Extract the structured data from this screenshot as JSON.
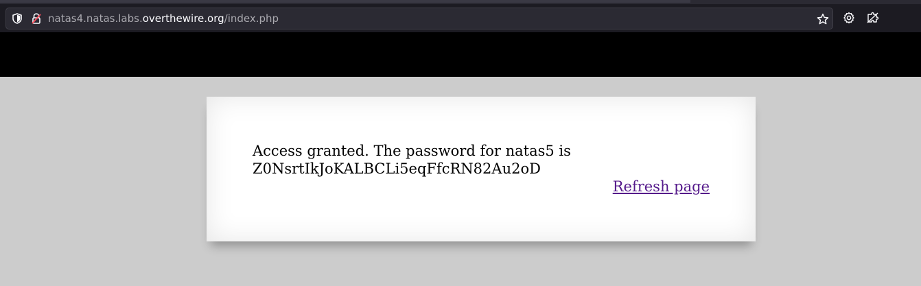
{
  "browser": {
    "url_prefix": "natas4.natas.labs.",
    "url_host": "overthewire.org",
    "url_path": "/index.php",
    "icons": {
      "tracking_protection": "shield-icon",
      "connection": "insecure-lock-icon",
      "bookmark": "star-icon",
      "settings": "gear-icon",
      "extension": "puzzle-icon"
    }
  },
  "page": {
    "message_line1": "Access granted. The password for natas5 is",
    "message_line2": "Z0NsrtIkJoKALBCLi5eqFfcRN82Au2oD",
    "refresh_link": "Refresh page"
  },
  "colors": {
    "header_bg": "#000000",
    "page_bg": "#cccccc",
    "card_bg": "#ffffff",
    "link_visited": "#551a8b",
    "chrome_bg": "#1c1b22"
  }
}
